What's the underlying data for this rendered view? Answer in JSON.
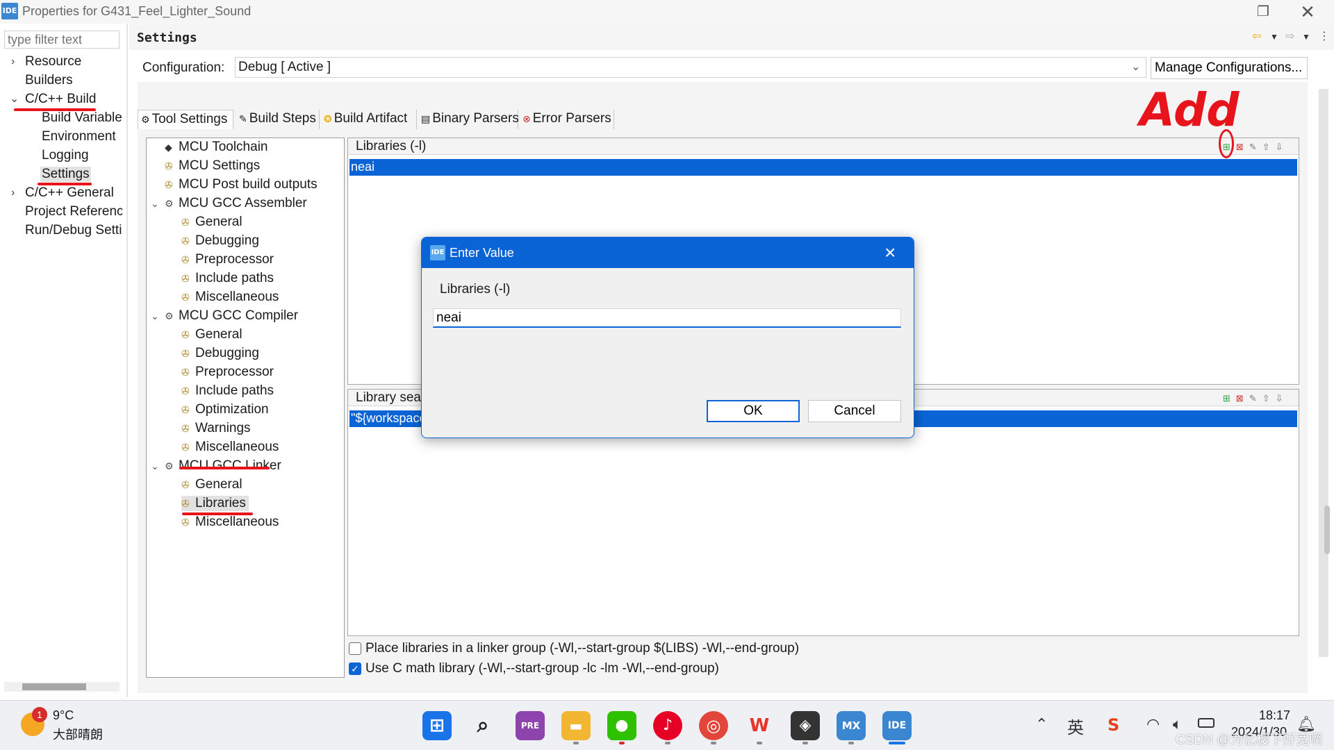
{
  "window": {
    "app_icon": "IDE",
    "title": "Properties for G431_Feel_Lighter_Sound",
    "restore_icon": "restore-icon",
    "close_icon": "close-icon"
  },
  "nav": {
    "filter_placeholder": "type filter text",
    "items": [
      {
        "label": "Resource",
        "chevron": ">"
      },
      {
        "label": "Builders",
        "chevron": ""
      },
      {
        "label": "C/C++ Build",
        "chevron": "v"
      },
      {
        "label": "Build Variables",
        "chevron": ""
      },
      {
        "label": "Environment",
        "chevron": ""
      },
      {
        "label": "Logging",
        "chevron": ""
      },
      {
        "label": "Settings",
        "chevron": "",
        "selected": true
      },
      {
        "label": "C/C++ General",
        "chevron": ">"
      },
      {
        "label": "Project References",
        "chevron": ""
      },
      {
        "label": "Run/Debug Settings",
        "chevron": ""
      }
    ]
  },
  "settings": {
    "title": "Settings",
    "configuration_label": "Configuration:",
    "configuration_value": "Debug  [ Active ]",
    "manage_button": "Manage Configurations..."
  },
  "tabs": [
    {
      "label": "Tool Settings",
      "icon": "tool-settings-icon",
      "active": true
    },
    {
      "label": "Build Steps",
      "icon": "build-steps-icon"
    },
    {
      "label": "Build Artifact",
      "icon": "build-artifact-icon"
    },
    {
      "label": "Binary Parsers",
      "icon": "binary-parsers-icon"
    },
    {
      "label": "Error Parsers",
      "icon": "error-parsers-icon"
    }
  ],
  "tree": {
    "items": [
      {
        "label": "MCU Toolchain",
        "level": 1
      },
      {
        "label": "MCU Settings",
        "level": 1
      },
      {
        "label": "MCU Post build outputs",
        "level": 1
      },
      {
        "label": "MCU GCC Assembler",
        "level": 1,
        "expanded": true
      },
      {
        "label": "General",
        "level": 2
      },
      {
        "label": "Debugging",
        "level": 2
      },
      {
        "label": "Preprocessor",
        "level": 2
      },
      {
        "label": "Include paths",
        "level": 2
      },
      {
        "label": "Miscellaneous",
        "level": 2
      },
      {
        "label": "MCU GCC Compiler",
        "level": 1,
        "expanded": true
      },
      {
        "label": "General",
        "level": 2
      },
      {
        "label": "Debugging",
        "level": 2
      },
      {
        "label": "Preprocessor",
        "level": 2
      },
      {
        "label": "Include paths",
        "level": 2
      },
      {
        "label": "Optimization",
        "level": 2
      },
      {
        "label": "Warnings",
        "level": 2
      },
      {
        "label": "Miscellaneous",
        "level": 2
      },
      {
        "label": "MCU GCC Linker",
        "level": 1,
        "expanded": true
      },
      {
        "label": "General",
        "level": 2
      },
      {
        "label": "Libraries",
        "level": 2,
        "selected": true
      },
      {
        "label": "Miscellaneous",
        "level": 2
      }
    ]
  },
  "libraries": {
    "header": "Libraries (-l)",
    "rows": [
      "neai"
    ]
  },
  "library_search": {
    "header": "Library search path (-L)",
    "rows": [
      "\"${workspace_loc:/${ProjName}/Middlewares}\""
    ]
  },
  "options": {
    "linker_group": {
      "label": "Place libraries in a linker group (-Wl,--start-group $(LIBS) -Wl,--end-group)",
      "checked": false
    },
    "c_math": {
      "label": "Use C math library (-Wl,--start-group -lc -lm -Wl,--end-group)",
      "checked": true
    }
  },
  "dialog": {
    "app_icon": "IDE",
    "title": "Enter Value",
    "label": "Libraries (-l)",
    "value": "neai",
    "ok": "OK",
    "cancel": "Cancel"
  },
  "annotation": {
    "text": "Add",
    "color": "#e8141c"
  },
  "taskbar": {
    "weather_badge": "1",
    "weather_temp": "9°C",
    "weather_desc": "大部晴朗",
    "apps": [
      {
        "name": "start",
        "glyph": "⊞",
        "color": "#1a73e8"
      },
      {
        "name": "search",
        "glyph": "⌕",
        "color": "#222222"
      },
      {
        "name": "copilot",
        "glyph": "PRE",
        "color": "#8e44ad"
      },
      {
        "name": "file-explorer",
        "glyph": "▬",
        "color": "#f2b632"
      },
      {
        "name": "wechat",
        "glyph": "●",
        "color": "#2dc100"
      },
      {
        "name": "netease-music",
        "glyph": "♪",
        "color": "#e60026"
      },
      {
        "name": "chrome",
        "glyph": "◎",
        "color": "#e2463a"
      },
      {
        "name": "wps",
        "glyph": "W",
        "color": "#e8332c"
      },
      {
        "name": "cubemx-board",
        "glyph": "◈",
        "color": "#333333"
      },
      {
        "name": "stm32cubemx",
        "glyph": "MX",
        "color": "#3b86d1"
      },
      {
        "name": "stm32cubeide",
        "glyph": "IDE",
        "color": "#3b86d1"
      }
    ],
    "ime": "英",
    "time": "18:17",
    "date": "2024/1/30"
  },
  "watermark": "CSDN @为忆樱下好宽啊"
}
